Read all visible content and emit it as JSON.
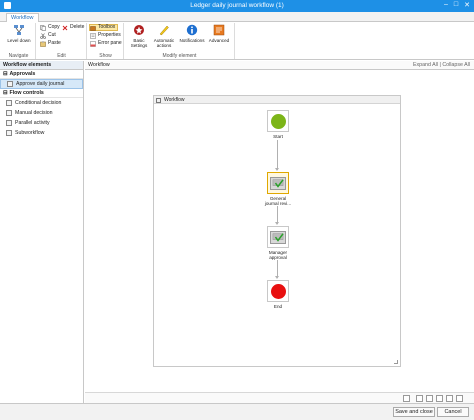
{
  "window": {
    "title": "Ledger daily journal workflow (1)",
    "minimize": "–",
    "maximize": "□",
    "close": "✕"
  },
  "tabs": [
    {
      "label": "Workflow"
    }
  ],
  "ribbon": {
    "navigate": {
      "label": "Navigate",
      "level_down": "Level down"
    },
    "edit": {
      "label": "Edit",
      "copy": "Copy",
      "delete": "Delete",
      "cut": "Cut",
      "paste": "Paste"
    },
    "show": {
      "label": "Show",
      "toolbox": "Toolbox",
      "properties": "Properties",
      "error_pane": "Error pane"
    },
    "modify": {
      "label": "Modify element",
      "basic_settings": "Basic Settings",
      "automatic_actions": "Automatic actions",
      "notifications": "Notifications",
      "advanced": "Advanced"
    }
  },
  "left_panel": {
    "title": "Workflow elements",
    "sections": [
      {
        "label": "Approvals",
        "items": [
          "Approve daily journal"
        ]
      },
      {
        "label": "Flow controls",
        "items": [
          "Conditional decision",
          "Manual decision",
          "Parallel activity",
          "Subworkflow"
        ]
      }
    ]
  },
  "canvas": {
    "header": "Workflow",
    "expand_all": "Expand All",
    "collapse_all": "Collapse All",
    "workflow_title": "Workflow",
    "nodes": {
      "start": "Start",
      "review": "General journal revi...",
      "approval": "Manager approval",
      "end": "End"
    }
  },
  "footer": {
    "save_close": "Save and close",
    "cancel": "Cancel"
  },
  "colors": {
    "titlebar": "#1e90e6",
    "start": "#7cb518",
    "end": "#e81010",
    "highlight": "#e0a800"
  }
}
